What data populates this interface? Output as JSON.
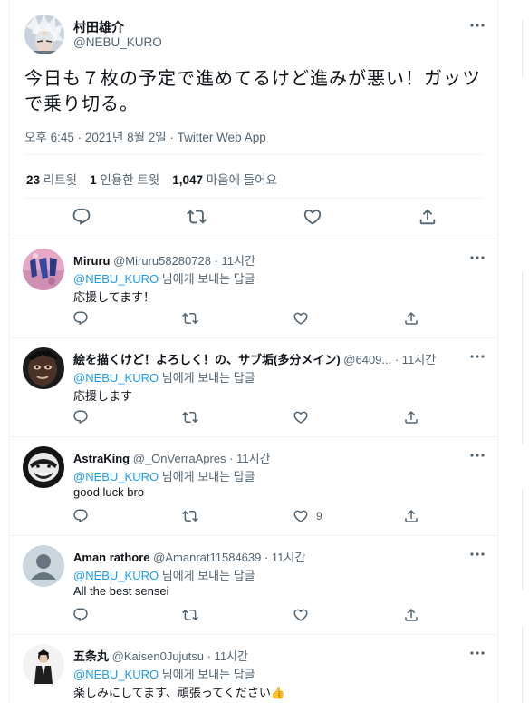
{
  "main_tweet": {
    "author_name": "村田雄介",
    "author_handle": "@NEBU_KURO",
    "text": "今日も７枚の予定で進めてるけど進みが悪い！ガッツで乗り切る。",
    "meta": "오후 6:45 · 2021년 8월 2일 · Twitter Web App",
    "stats": {
      "retweets_count": "23",
      "retweets_label": "리트윗",
      "quotes_count": "1",
      "quotes_label": "인용한 트윗",
      "likes_count": "1,047",
      "likes_label": "마음에 들어요"
    }
  },
  "replies": [
    {
      "name": "Miruru",
      "handle_time": "@Miruru58280728 · 11시간",
      "mention": "@NEBU_KURO",
      "replying_suffix": "님에게 보내는 답글",
      "text": "応援してます！",
      "like_count": ""
    },
    {
      "name": "絵を描くけど！よろしく！の、サブ垢(多分メイン)",
      "handle_time": "@6409... · 11시간",
      "mention": "@NEBU_KURO",
      "replying_suffix": "님에게 보내는 답글",
      "text": "応援します",
      "like_count": ""
    },
    {
      "name": "AstraKing",
      "handle_time": "@_OnVerraApres · 11시간",
      "mention": "@NEBU_KURO",
      "replying_suffix": "님에게 보내는 답글",
      "text": "good luck bro",
      "like_count": "9"
    },
    {
      "name": "Aman rathore",
      "handle_time": "@Amanrat11584639 · 11시간",
      "mention": "@NEBU_KURO",
      "replying_suffix": "님에게 보내는 답글",
      "text": "All the best sensei",
      "like_count": ""
    },
    {
      "name": "五条丸",
      "handle_time": "@Kaisen0Jujutsu · 11시간",
      "mention": "@NEBU_KURO",
      "replying_suffix": "님에게 보내는 답글",
      "text": "楽しみにしてます、頑張ってください👍",
      "like_count": ""
    }
  ],
  "icons": [
    "more-icon",
    "reply-icon",
    "retweet-icon",
    "like-icon",
    "share-icon"
  ],
  "colors": {
    "link": "#1d9bf0",
    "secondary_text": "#536471",
    "primary_text": "#0f1419",
    "border": "#eff3f4"
  }
}
